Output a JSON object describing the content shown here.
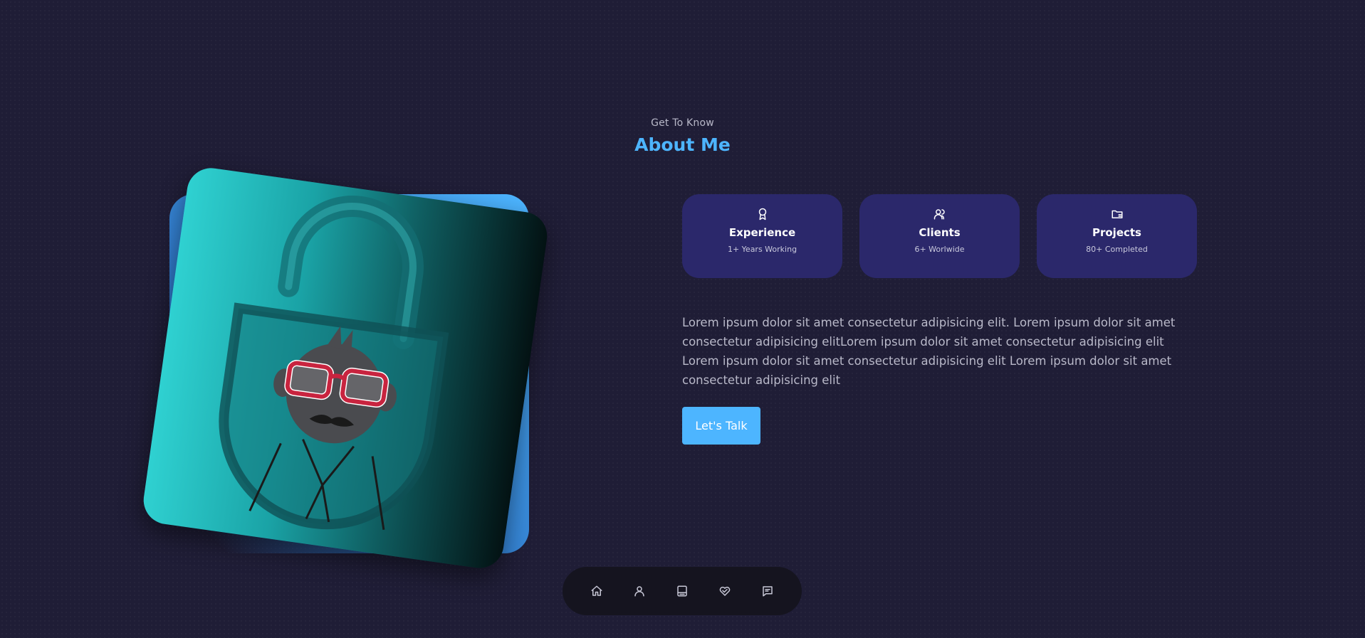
{
  "header": {
    "subtitle": "Get To Know",
    "title": "About Me"
  },
  "cards": [
    {
      "icon": "award-icon",
      "title": "Experience",
      "sub": "1+ Years Working"
    },
    {
      "icon": "users-icon",
      "title": "Clients",
      "sub": "6+ Worlwide"
    },
    {
      "icon": "folder-icon",
      "title": "Projects",
      "sub": "80+ Completed"
    }
  ],
  "about": {
    "paragraph": "Lorem ipsum dolor sit amet consectetur adipisicing elit. Lorem ipsum dolor sit amet consectetur adipisicing elitLorem ipsum dolor sit amet consectetur adipisicing elit Lorem ipsum dolor sit amet consectetur adipisicing elit Lorem ipsum dolor sit amet consectetur adipisicing elit",
    "cta_label": "Let's Talk"
  },
  "nav": [
    "home-icon",
    "user-icon",
    "book-icon",
    "handshake-icon",
    "message-icon"
  ],
  "colors": {
    "background": "#1f1d36",
    "accent": "#4db5ff",
    "card": "#2b286b",
    "nav": "#15141f"
  }
}
